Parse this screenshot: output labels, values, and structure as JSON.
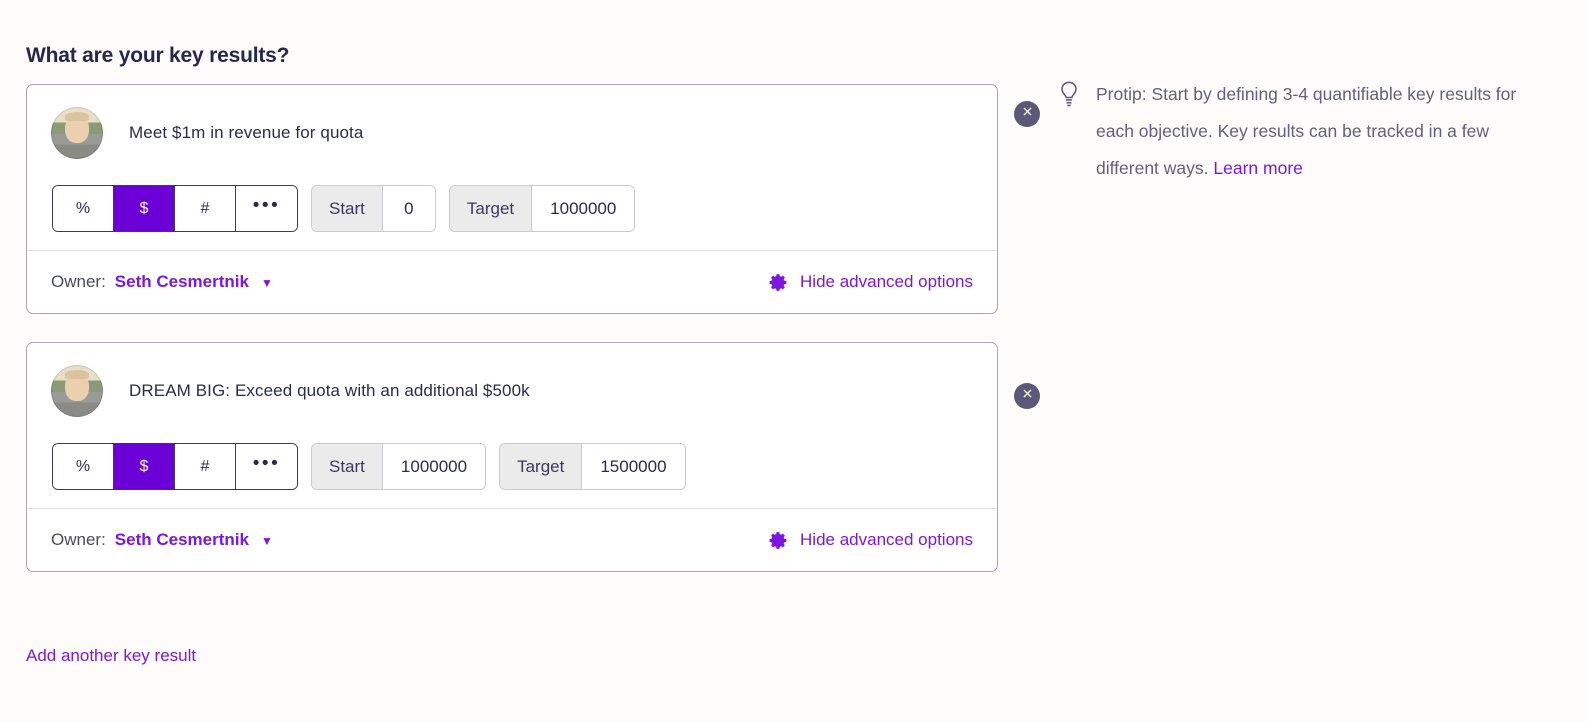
{
  "heading": "What are your key results?",
  "key_results": [
    {
      "title": "Meet $1m in revenue for quota",
      "avatar_name": "seth-avatar",
      "unit_options": [
        "%",
        "$",
        "#",
        "•••"
      ],
      "selected_unit": "$",
      "start_label": "Start",
      "start_value": "0",
      "target_label": "Target",
      "target_value": "1000000",
      "owner_label": "Owner:",
      "owner_name": "Seth Cesmertnik",
      "advanced_label": "Hide advanced options",
      "delete_title": "Remove key result"
    },
    {
      "title": "DREAM BIG: Exceed quota with an additional $500k",
      "avatar_name": "seth-avatar",
      "unit_options": [
        "%",
        "$",
        "#",
        "•••"
      ],
      "selected_unit": "$",
      "start_label": "Start",
      "start_value": "1000000",
      "target_label": "Target",
      "target_value": "1500000",
      "owner_label": "Owner:",
      "owner_name": "Seth Cesmertnik",
      "advanced_label": "Hide advanced options",
      "delete_title": "Remove key result"
    }
  ],
  "add_link": "Add another key result",
  "protip": {
    "icon": "lightbulb-icon",
    "text": "Protip: Start by defining 3-4 quantifiable key results for each objective. Key results can be tracked in a few different ways.",
    "learn_more": "Learn more"
  },
  "colors": {
    "accent_purple": "#7b16e0",
    "selected_purple": "#6b00d7",
    "page_background": "#fdfcfa",
    "card_border": "#a9a3bd",
    "text_dark": "#2b2a52",
    "muted_text": "#62607d",
    "delete_circle": "#5c5877",
    "field_label_bg": "#ebebeb"
  }
}
